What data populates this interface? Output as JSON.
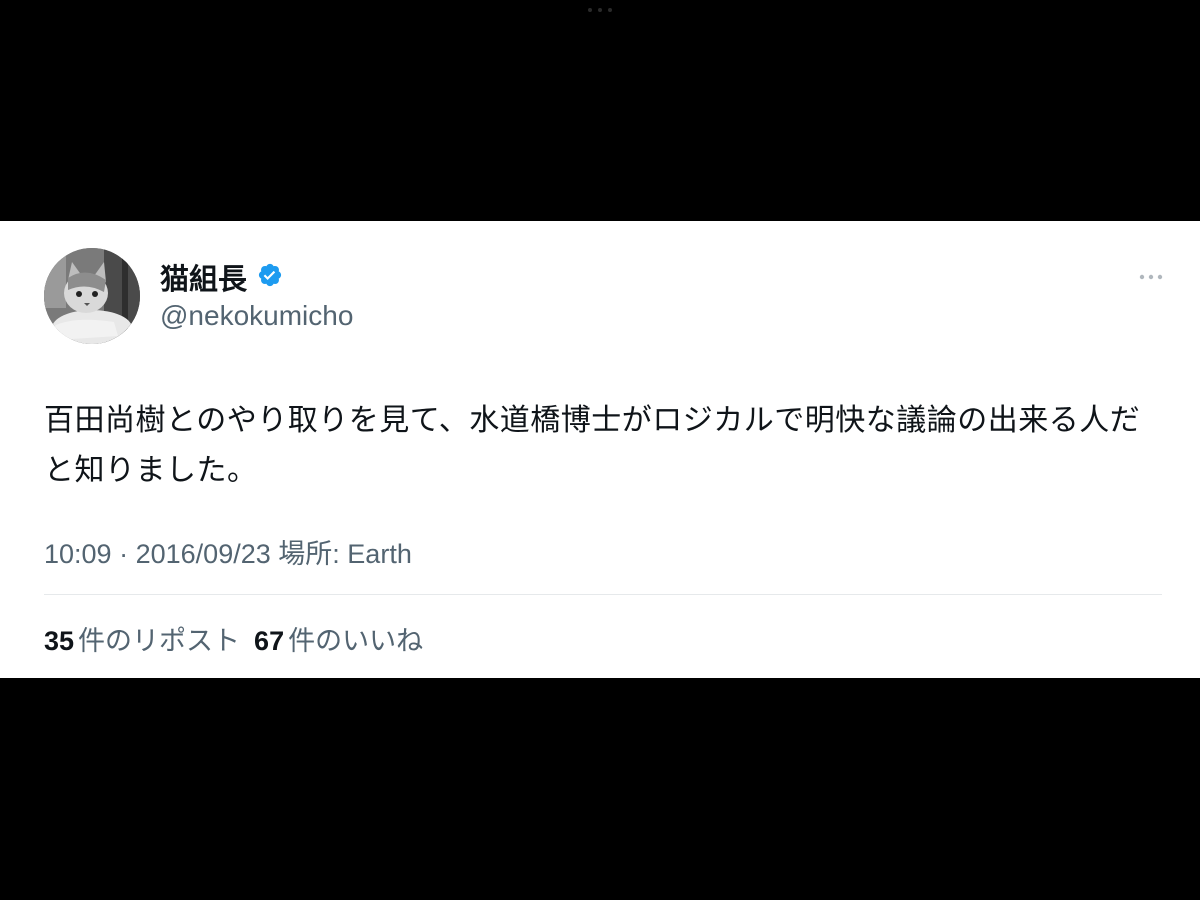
{
  "tweet": {
    "display_name": "猫組長",
    "handle": "@nekokumicho",
    "text": "百田尚樹とのやり取りを見て、水道橋博士がロジカルで明快な議論の出来る人だと知りました。",
    "time": "10:09",
    "separator": "·",
    "date": "2016/09/23",
    "location_label": "場所:",
    "location": "Earth"
  },
  "stats": {
    "reposts_count": "35",
    "reposts_label": "件のリポスト",
    "likes_count": "67",
    "likes_label": "件のいいね"
  },
  "icons": {
    "verified": "verified-badge-icon",
    "more": "more-options-icon"
  },
  "colors": {
    "background": "#000000",
    "card": "#ffffff",
    "primary_text": "#0f1419",
    "secondary_text": "#536471",
    "verified_blue": "#1d9bf0"
  }
}
